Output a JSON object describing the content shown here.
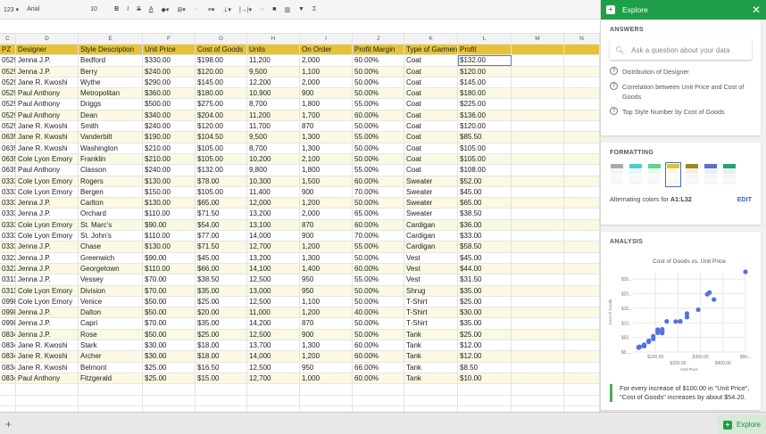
{
  "toolbar": {
    "format_123": "123 ▾",
    "font": "Arial",
    "size": "10",
    "bold": "B",
    "italic": "I",
    "strike": "S",
    "text_color": "A",
    "sigma": "Σ"
  },
  "columns": [
    "C",
    "D",
    "E",
    "F",
    "G",
    "H",
    "I",
    "J",
    "K",
    "L",
    "M",
    "N"
  ],
  "headers": [
    "PZ",
    "Designer",
    "Style Description",
    "Unit Price",
    "Cost of Goods",
    "Units",
    "On Order",
    "Profit Margin",
    "Type of Garment",
    "Profit"
  ],
  "rows": [
    [
      "0529",
      "Jenna J.P.",
      "Bedford",
      "$330.00",
      "$198.00",
      "11,200",
      "2,000",
      "60.00%",
      "Coat",
      "$132.00"
    ],
    [
      "0529",
      "Jenna J.P.",
      "Berry",
      "$240.00",
      "$120.00",
      "9,500",
      "1,100",
      "50.00%",
      "Coat",
      "$120.00"
    ],
    [
      "0529",
      "Jane R. Kwoshi",
      "Wythe",
      "$290.00",
      "$145.00",
      "12,200",
      "2,000",
      "50.00%",
      "Coat",
      "$145.00"
    ],
    [
      "0529",
      "Paul Anthony",
      "Metropolitan",
      "$360.00",
      "$180.00",
      "10,900",
      "900",
      "50.00%",
      "Coat",
      "$180.00"
    ],
    [
      "0529",
      "Paul Anthony",
      "Driggs",
      "$500.00",
      "$275.00",
      "8,700",
      "1,800",
      "55.00%",
      "Coat",
      "$225.00"
    ],
    [
      "0529",
      "Paul Anthony",
      "Dean",
      "$340.00",
      "$204.00",
      "11,200",
      "1,700",
      "60.00%",
      "Coat",
      "$136.00"
    ],
    [
      "0529",
      "Jane R. Kwoshi",
      "Smith",
      "$240.00",
      "$120.00",
      "11,700",
      "870",
      "50.00%",
      "Coat",
      "$120.00"
    ],
    [
      "0635",
      "Jane R. Kwoshi",
      "Vanderbilt",
      "$190.00",
      "$104.50",
      "9,500",
      "1,300",
      "55.00%",
      "Coat",
      "$85.50"
    ],
    [
      "0635",
      "Jane R. Kwoshi",
      "Washington",
      "$210.00",
      "$105.00",
      "8,700",
      "1,300",
      "50.00%",
      "Coat",
      "$105.00"
    ],
    [
      "0635",
      "Cole Lyon Emory",
      "Franklin",
      "$210.00",
      "$105.00",
      "10,200",
      "2,100",
      "50.00%",
      "Coat",
      "$105.00"
    ],
    [
      "0635",
      "Paul Anthony",
      "Classon",
      "$240.00",
      "$132.00",
      "9,800",
      "1,800",
      "55.00%",
      "Coat",
      "$108.00"
    ],
    [
      "0333",
      "Cole Lyon Emory",
      "Rogers",
      "$130.00",
      "$78.00",
      "10,300",
      "1,500",
      "60.00%",
      "Sweater",
      "$52.00"
    ],
    [
      "0333",
      "Cole Lyon Emory",
      "Bergen",
      "$150.00",
      "$105.00",
      "11,400",
      "900",
      "70.00%",
      "Sweater",
      "$45.00"
    ],
    [
      "0333",
      "Jenna J.P.",
      "Carlton",
      "$130.00",
      "$65.00",
      "12,000",
      "1,200",
      "50.00%",
      "Sweater",
      "$65.00"
    ],
    [
      "0333",
      "Jenna J.P.",
      "Orchard",
      "$110.00",
      "$71.50",
      "13,200",
      "2,000",
      "65.00%",
      "Sweater",
      "$38.50"
    ],
    [
      "0333",
      "Cole Lyon Emory",
      "St. Marc's",
      "$90.00",
      "$54.00",
      "13,100",
      "870",
      "60.00%",
      "Cardigan",
      "$36.00"
    ],
    [
      "0333",
      "Cole Lyon Emory",
      "St. John's",
      "$110.00",
      "$77.00",
      "14,000",
      "900",
      "70.00%",
      "Cardigan",
      "$33.00"
    ],
    [
      "0333",
      "Jenna J.P.",
      "Chase",
      "$130.00",
      "$71.50",
      "12,700",
      "1,200",
      "55.00%",
      "Cardigan",
      "$58.50"
    ],
    [
      "0322",
      "Jenna J.P.",
      "Greenwich",
      "$90.00",
      "$45.00",
      "13,200",
      "1,300",
      "50.00%",
      "Vest",
      "$45.00"
    ],
    [
      "0322",
      "Jenna J.P.",
      "Georgetown",
      "$110.00",
      "$66.00",
      "14,100",
      "1,400",
      "60.00%",
      "Vest",
      "$44.00"
    ],
    [
      "0311",
      "Jenna J.P.",
      "Vessey",
      "$70.00",
      "$38.50",
      "12,500",
      "950",
      "55.00%",
      "Vest",
      "$31.50"
    ],
    [
      "0311",
      "Cole Lyon Emory",
      "Division",
      "$70.00",
      "$35.00",
      "13,000",
      "950",
      "50.00%",
      "Shrug",
      "$35.00"
    ],
    [
      "0998",
      "Cole Lyon Emory",
      "Venice",
      "$50.00",
      "$25.00",
      "12,500",
      "1,100",
      "50.00%",
      "T-Shirt",
      "$25.00"
    ],
    [
      "0998",
      "Jenna J.P.",
      "Dalton",
      "$50.00",
      "$20.00",
      "11,000",
      "1,200",
      "40.00%",
      "T-Shirt",
      "$30.00"
    ],
    [
      "0998",
      "Jenna J.P.",
      "Capri",
      "$70.00",
      "$35.00",
      "14,200",
      "870",
      "50.00%",
      "T-Shirt",
      "$35.00"
    ],
    [
      "0834",
      "Jenna J.P.",
      "Rose",
      "$50.00",
      "$25.00",
      "12,500",
      "900",
      "50.00%",
      "Tank",
      "$25.00"
    ],
    [
      "0834",
      "Jane R. Kwoshi",
      "Stark",
      "$30.00",
      "$18.00",
      "13,700",
      "1,300",
      "60.00%",
      "Tank",
      "$12.00"
    ],
    [
      "0834",
      "Jane R. Kwoshi",
      "Archer",
      "$30.00",
      "$18.00",
      "14,000",
      "1,200",
      "60.00%",
      "Tank",
      "$12.00"
    ],
    [
      "0834",
      "Jane R. Kwoshi",
      "Belmont",
      "$25.00",
      "$16.50",
      "12,500",
      "950",
      "66.00%",
      "Tank",
      "$8.50"
    ],
    [
      "0834",
      "Paul Anthony",
      "Fitzgerald",
      "$25.00",
      "$15.00",
      "12,700",
      "1,000",
      "60.00%",
      "Tank",
      "$10.00"
    ]
  ],
  "explore": {
    "title": "Explore",
    "close": "✕",
    "answers_heading": "ANSWERS",
    "search_placeholder": "Ask a question about your data",
    "questions": [
      "Distribution of Designer",
      "Correlation between Unit Price and Cost of Goods",
      "Top Style Number by Cost of Goods"
    ],
    "formatting_heading": "FORMATTING",
    "swatch_colors": [
      "#aaaaaa",
      "#4dd0c8",
      "#5fd38a",
      "#e2c22e",
      "#a8831a",
      "#5b6fd6",
      "#1fa17a"
    ],
    "selected_swatch": 3,
    "alternating_label": "Alternating colors for ",
    "alternating_range": "A1:L32",
    "edit": "EDIT",
    "analysis_heading": "ANALYSIS",
    "insight": "For every increase of $100.00 in \"Unit Price\", \"Cost of Goods\" increases by about $54.20."
  },
  "chart_data": {
    "type": "scatter",
    "title": "Cost of Goods vs. Unit Price",
    "xlabel": "Unit Price",
    "ylabel": "Cost of Goods",
    "x_ticks": [
      "$100.00",
      "$200.00",
      "$300.00",
      "$400.00",
      "$50..."
    ],
    "y_ticks": [
      "$0....",
      "$50..",
      "$10..",
      "$15..",
      "$20..",
      "$25.."
    ],
    "xlim": [
      0,
      500
    ],
    "ylim": [
      0,
      275
    ],
    "grid": true,
    "point_color": "#5470e0",
    "points": [
      [
        330,
        198
      ],
      [
        240,
        120
      ],
      [
        290,
        145
      ],
      [
        360,
        180
      ],
      [
        500,
        275
      ],
      [
        340,
        204
      ],
      [
        240,
        120
      ],
      [
        190,
        104.5
      ],
      [
        210,
        105
      ],
      [
        210,
        105
      ],
      [
        240,
        132
      ],
      [
        130,
        78
      ],
      [
        150,
        105
      ],
      [
        130,
        65
      ],
      [
        110,
        71.5
      ],
      [
        90,
        54
      ],
      [
        110,
        77
      ],
      [
        130,
        71.5
      ],
      [
        90,
        45
      ],
      [
        110,
        66
      ],
      [
        70,
        38.5
      ],
      [
        70,
        35
      ],
      [
        50,
        25
      ],
      [
        50,
        20
      ],
      [
        70,
        35
      ],
      [
        50,
        25
      ],
      [
        30,
        18
      ],
      [
        30,
        18
      ],
      [
        25,
        16.5
      ],
      [
        25,
        15
      ]
    ]
  },
  "bottom": {
    "add": "+",
    "explore": "Explore"
  }
}
